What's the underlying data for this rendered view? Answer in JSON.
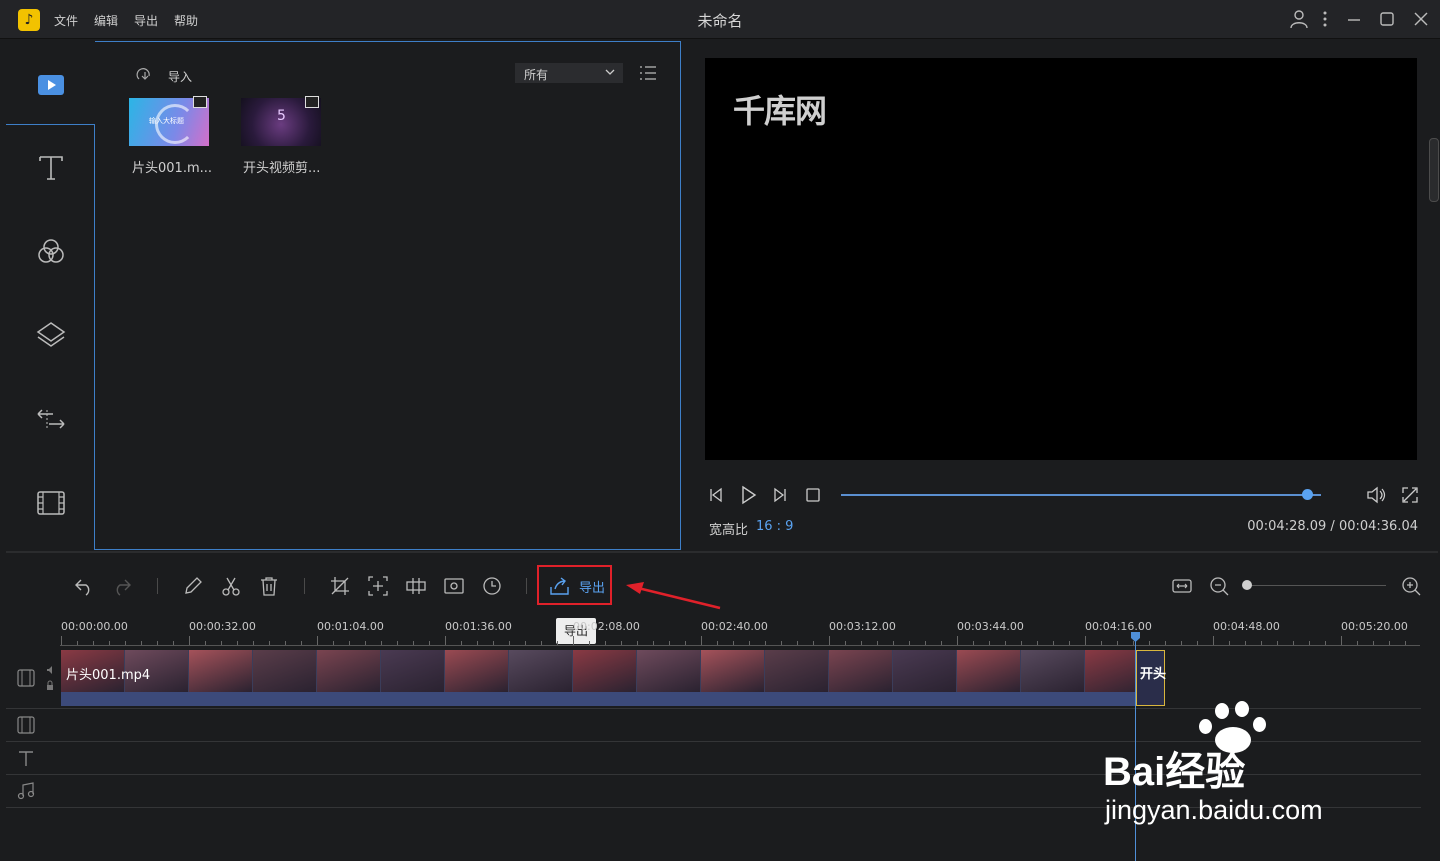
{
  "app": {
    "title": "未命名",
    "menu": [
      "文件",
      "编辑",
      "导出",
      "帮助"
    ],
    "logo_glyph": "♪",
    "accent_color": "#5aa2f0",
    "highlight_color": "#e0212a"
  },
  "media_panel": {
    "import_label": "导入",
    "filter_value": "所有",
    "items": [
      {
        "name": "片头001.m...",
        "thumb_text": "输入大标题"
      },
      {
        "name": "开头视频剪...",
        "thumb_text": "5"
      }
    ]
  },
  "preview": {
    "watermark": "千库网",
    "ratio_label": "宽高比",
    "ratio_value": "16 : 9",
    "timecode": "00:04:28.09 / 00:04:36.04",
    "progress": 0.9705
  },
  "toolbar": {
    "export_label": "导出",
    "tooltip": "导出",
    "zoom_level": 0.03
  },
  "timeline": {
    "ticks": [
      "00:00:00.00",
      "00:00:32.00",
      "00:01:04.00",
      "00:01:36.00",
      "00:02:08.00",
      "00:02:40.00",
      "00:03:12.00",
      "00:03:44.00",
      "00:04:16.00",
      "00:04:48.00",
      "00:05:20.00"
    ],
    "clip_main_label": "片头001.mp4",
    "clip_second_label": "开头"
  },
  "watermark_brand": {
    "text": "Bai经验",
    "url": "jingyan.baidu.com"
  }
}
